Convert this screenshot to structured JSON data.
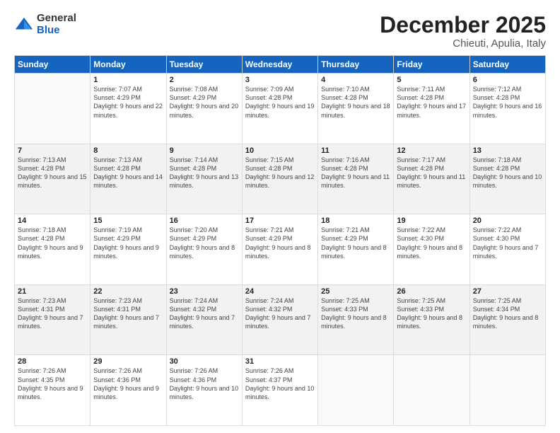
{
  "logo": {
    "general": "General",
    "blue": "Blue"
  },
  "title": "December 2025",
  "location": "Chieuti, Apulia, Italy",
  "days": [
    "Sunday",
    "Monday",
    "Tuesday",
    "Wednesday",
    "Thursday",
    "Friday",
    "Saturday"
  ],
  "weeks": [
    [
      {
        "day": "",
        "sunrise": "",
        "sunset": "",
        "daylight": ""
      },
      {
        "day": "1",
        "sunrise": "Sunrise: 7:07 AM",
        "sunset": "Sunset: 4:29 PM",
        "daylight": "Daylight: 9 hours and 22 minutes."
      },
      {
        "day": "2",
        "sunrise": "Sunrise: 7:08 AM",
        "sunset": "Sunset: 4:29 PM",
        "daylight": "Daylight: 9 hours and 20 minutes."
      },
      {
        "day": "3",
        "sunrise": "Sunrise: 7:09 AM",
        "sunset": "Sunset: 4:28 PM",
        "daylight": "Daylight: 9 hours and 19 minutes."
      },
      {
        "day": "4",
        "sunrise": "Sunrise: 7:10 AM",
        "sunset": "Sunset: 4:28 PM",
        "daylight": "Daylight: 9 hours and 18 minutes."
      },
      {
        "day": "5",
        "sunrise": "Sunrise: 7:11 AM",
        "sunset": "Sunset: 4:28 PM",
        "daylight": "Daylight: 9 hours and 17 minutes."
      },
      {
        "day": "6",
        "sunrise": "Sunrise: 7:12 AM",
        "sunset": "Sunset: 4:28 PM",
        "daylight": "Daylight: 9 hours and 16 minutes."
      }
    ],
    [
      {
        "day": "7",
        "sunrise": "Sunrise: 7:13 AM",
        "sunset": "Sunset: 4:28 PM",
        "daylight": "Daylight: 9 hours and 15 minutes."
      },
      {
        "day": "8",
        "sunrise": "Sunrise: 7:13 AM",
        "sunset": "Sunset: 4:28 PM",
        "daylight": "Daylight: 9 hours and 14 minutes."
      },
      {
        "day": "9",
        "sunrise": "Sunrise: 7:14 AM",
        "sunset": "Sunset: 4:28 PM",
        "daylight": "Daylight: 9 hours and 13 minutes."
      },
      {
        "day": "10",
        "sunrise": "Sunrise: 7:15 AM",
        "sunset": "Sunset: 4:28 PM",
        "daylight": "Daylight: 9 hours and 12 minutes."
      },
      {
        "day": "11",
        "sunrise": "Sunrise: 7:16 AM",
        "sunset": "Sunset: 4:28 PM",
        "daylight": "Daylight: 9 hours and 11 minutes."
      },
      {
        "day": "12",
        "sunrise": "Sunrise: 7:17 AM",
        "sunset": "Sunset: 4:28 PM",
        "daylight": "Daylight: 9 hours and 11 minutes."
      },
      {
        "day": "13",
        "sunrise": "Sunrise: 7:18 AM",
        "sunset": "Sunset: 4:28 PM",
        "daylight": "Daylight: 9 hours and 10 minutes."
      }
    ],
    [
      {
        "day": "14",
        "sunrise": "Sunrise: 7:18 AM",
        "sunset": "Sunset: 4:28 PM",
        "daylight": "Daylight: 9 hours and 9 minutes."
      },
      {
        "day": "15",
        "sunrise": "Sunrise: 7:19 AM",
        "sunset": "Sunset: 4:29 PM",
        "daylight": "Daylight: 9 hours and 9 minutes."
      },
      {
        "day": "16",
        "sunrise": "Sunrise: 7:20 AM",
        "sunset": "Sunset: 4:29 PM",
        "daylight": "Daylight: 9 hours and 8 minutes."
      },
      {
        "day": "17",
        "sunrise": "Sunrise: 7:21 AM",
        "sunset": "Sunset: 4:29 PM",
        "daylight": "Daylight: 9 hours and 8 minutes."
      },
      {
        "day": "18",
        "sunrise": "Sunrise: 7:21 AM",
        "sunset": "Sunset: 4:29 PM",
        "daylight": "Daylight: 9 hours and 8 minutes."
      },
      {
        "day": "19",
        "sunrise": "Sunrise: 7:22 AM",
        "sunset": "Sunset: 4:30 PM",
        "daylight": "Daylight: 9 hours and 8 minutes."
      },
      {
        "day": "20",
        "sunrise": "Sunrise: 7:22 AM",
        "sunset": "Sunset: 4:30 PM",
        "daylight": "Daylight: 9 hours and 7 minutes."
      }
    ],
    [
      {
        "day": "21",
        "sunrise": "Sunrise: 7:23 AM",
        "sunset": "Sunset: 4:31 PM",
        "daylight": "Daylight: 9 hours and 7 minutes."
      },
      {
        "day": "22",
        "sunrise": "Sunrise: 7:23 AM",
        "sunset": "Sunset: 4:31 PM",
        "daylight": "Daylight: 9 hours and 7 minutes."
      },
      {
        "day": "23",
        "sunrise": "Sunrise: 7:24 AM",
        "sunset": "Sunset: 4:32 PM",
        "daylight": "Daylight: 9 hours and 7 minutes."
      },
      {
        "day": "24",
        "sunrise": "Sunrise: 7:24 AM",
        "sunset": "Sunset: 4:32 PM",
        "daylight": "Daylight: 9 hours and 7 minutes."
      },
      {
        "day": "25",
        "sunrise": "Sunrise: 7:25 AM",
        "sunset": "Sunset: 4:33 PM",
        "daylight": "Daylight: 9 hours and 8 minutes."
      },
      {
        "day": "26",
        "sunrise": "Sunrise: 7:25 AM",
        "sunset": "Sunset: 4:33 PM",
        "daylight": "Daylight: 9 hours and 8 minutes."
      },
      {
        "day": "27",
        "sunrise": "Sunrise: 7:25 AM",
        "sunset": "Sunset: 4:34 PM",
        "daylight": "Daylight: 9 hours and 8 minutes."
      }
    ],
    [
      {
        "day": "28",
        "sunrise": "Sunrise: 7:26 AM",
        "sunset": "Sunset: 4:35 PM",
        "daylight": "Daylight: 9 hours and 9 minutes."
      },
      {
        "day": "29",
        "sunrise": "Sunrise: 7:26 AM",
        "sunset": "Sunset: 4:36 PM",
        "daylight": "Daylight: 9 hours and 9 minutes."
      },
      {
        "day": "30",
        "sunrise": "Sunrise: 7:26 AM",
        "sunset": "Sunset: 4:36 PM",
        "daylight": "Daylight: 9 hours and 10 minutes."
      },
      {
        "day": "31",
        "sunrise": "Sunrise: 7:26 AM",
        "sunset": "Sunset: 4:37 PM",
        "daylight": "Daylight: 9 hours and 10 minutes."
      },
      {
        "day": "",
        "sunrise": "",
        "sunset": "",
        "daylight": ""
      },
      {
        "day": "",
        "sunrise": "",
        "sunset": "",
        "daylight": ""
      },
      {
        "day": "",
        "sunrise": "",
        "sunset": "",
        "daylight": ""
      }
    ]
  ]
}
